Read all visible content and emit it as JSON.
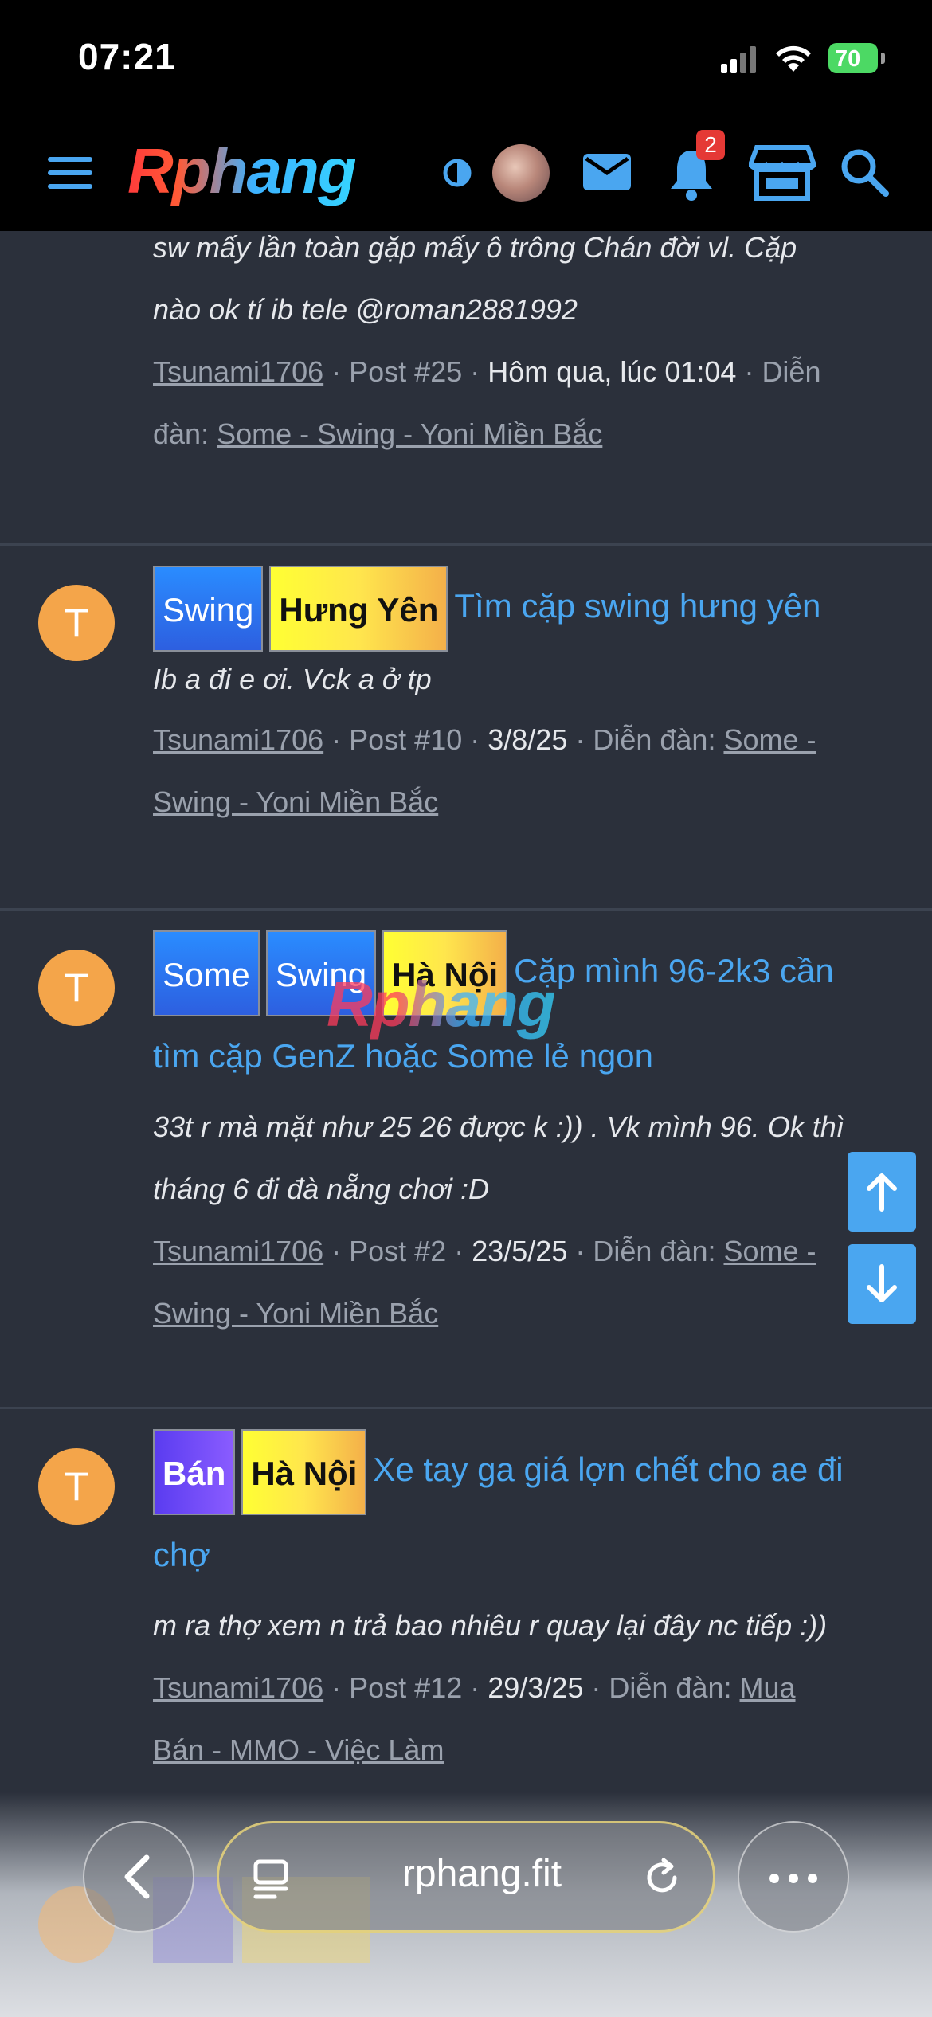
{
  "status_bar": {
    "time": "07:21",
    "battery": "70"
  },
  "header": {
    "logo": "Rphang",
    "notification_count": "2"
  },
  "partial_result": {
    "snippet_lines": [
      "sw mấy lần toàn gặp mấy ô trông Chán đời vl. Cặp",
      "nào ok tí ib tele @roman2881992"
    ],
    "meta": {
      "author": "Tsunami1706",
      "post": "Post #25",
      "date": "Hôm qua, lúc 01:04",
      "forum_prefix": "Diễn",
      "forum_prefix2": "đàn:",
      "forum": "Some - Swing - Yoni Miền Bắc"
    }
  },
  "results": [
    {
      "avatar_letter": "T",
      "tags": [
        {
          "label": "Swing",
          "style": "blue"
        },
        {
          "label": "Hưng Yên",
          "style": "yellow"
        }
      ],
      "title": "Tìm cặp swing hưng yên",
      "title_cont": "",
      "snippet": [
        "Ib a đi e ơi. Vck a ở tp"
      ],
      "author": "Tsunami1706",
      "post": "Post #10",
      "date": "3/8/25",
      "forum_label": "Diễn đàn:",
      "forum_a": "Some -",
      "forum_b": "Swing - Yoni Miền Bắc"
    },
    {
      "avatar_letter": "T",
      "tags": [
        {
          "label": "Some",
          "style": "blue"
        },
        {
          "label": "Swing",
          "style": "blue"
        },
        {
          "label": "Hà Nội",
          "style": "yellow"
        }
      ],
      "title": "Cặp mình 96-2k3 cần",
      "title_cont": "tìm cặp GenZ hoặc Some lẻ ngon",
      "snippet": [
        "33t r mà mặt như 25 26 được k :)) . Vk mình 96. Ok thì",
        "tháng 6 đi đà nẵng chơi :D"
      ],
      "author": "Tsunami1706",
      "post": "Post #2",
      "date": "23/5/25",
      "forum_label": "Diễn đàn:",
      "forum_a": "Some -",
      "forum_b": "Swing - Yoni Miền Bắc"
    },
    {
      "avatar_letter": "T",
      "tags": [
        {
          "label": "Bán",
          "style": "purple"
        },
        {
          "label": "Hà Nội",
          "style": "yellow"
        }
      ],
      "title": "Xe tay ga giá lợn chết cho ae đi",
      "title_cont": "chợ",
      "snippet": [
        "m ra thợ xem n trả bao nhiêu r quay lại đây nc tiếp :))"
      ],
      "author": "Tsunami1706",
      "post": "Post #12",
      "date": "29/3/25",
      "forum_label": "Diễn đàn:",
      "forum_a": "Mua",
      "forum_b": "Bán - MMO - Việc Làm"
    }
  ],
  "watermark": "Rphang",
  "browser": {
    "url": "rphang.fit"
  },
  "colors": {
    "accent": "#4aa6f0",
    "background": "#2b303b",
    "avatar": "#f4a54a"
  }
}
